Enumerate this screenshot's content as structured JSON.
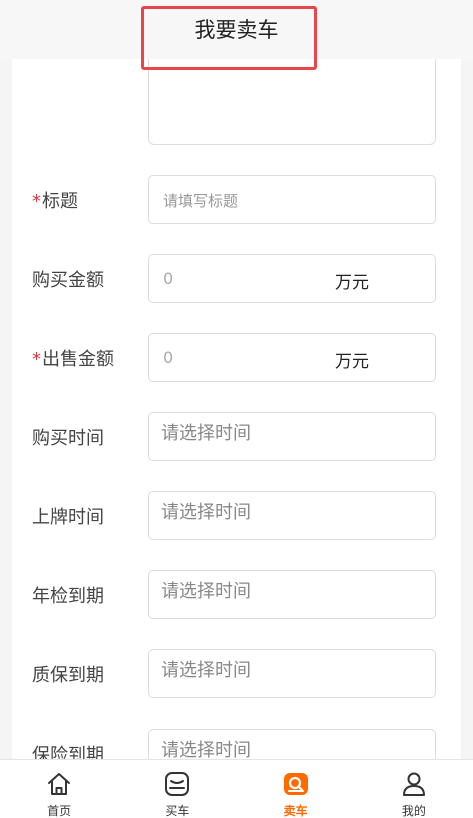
{
  "header": {
    "title": "我要卖车"
  },
  "form": {
    "title_field": {
      "label": "标题",
      "placeholder": "请填写标题"
    },
    "purchase_amount": {
      "label": "购买金额",
      "value": "0",
      "unit": "万元"
    },
    "sale_amount": {
      "label": "出售金额",
      "value": "0",
      "unit": "万元"
    },
    "purchase_time": {
      "label": "购买时间",
      "placeholder": "请选择时间"
    },
    "plate_time": {
      "label": "上牌时间",
      "placeholder": "请选择时间"
    },
    "inspection_due": {
      "label": "年检到期",
      "placeholder": "请选择时间"
    },
    "warranty_due": {
      "label": "质保到期",
      "placeholder": "请选择时间"
    },
    "insurance_due": {
      "label": "保险到期",
      "placeholder": "请选择时间"
    }
  },
  "required_mark": "*",
  "tabbar": {
    "items": [
      {
        "label": "首页",
        "icon": "home-icon"
      },
      {
        "label": "买车",
        "icon": "car-front-icon"
      },
      {
        "label": "卖车",
        "icon": "sell-car-icon",
        "active": true
      },
      {
        "label": "我的",
        "icon": "user-icon"
      }
    ],
    "active_color": "#ff6a00"
  }
}
